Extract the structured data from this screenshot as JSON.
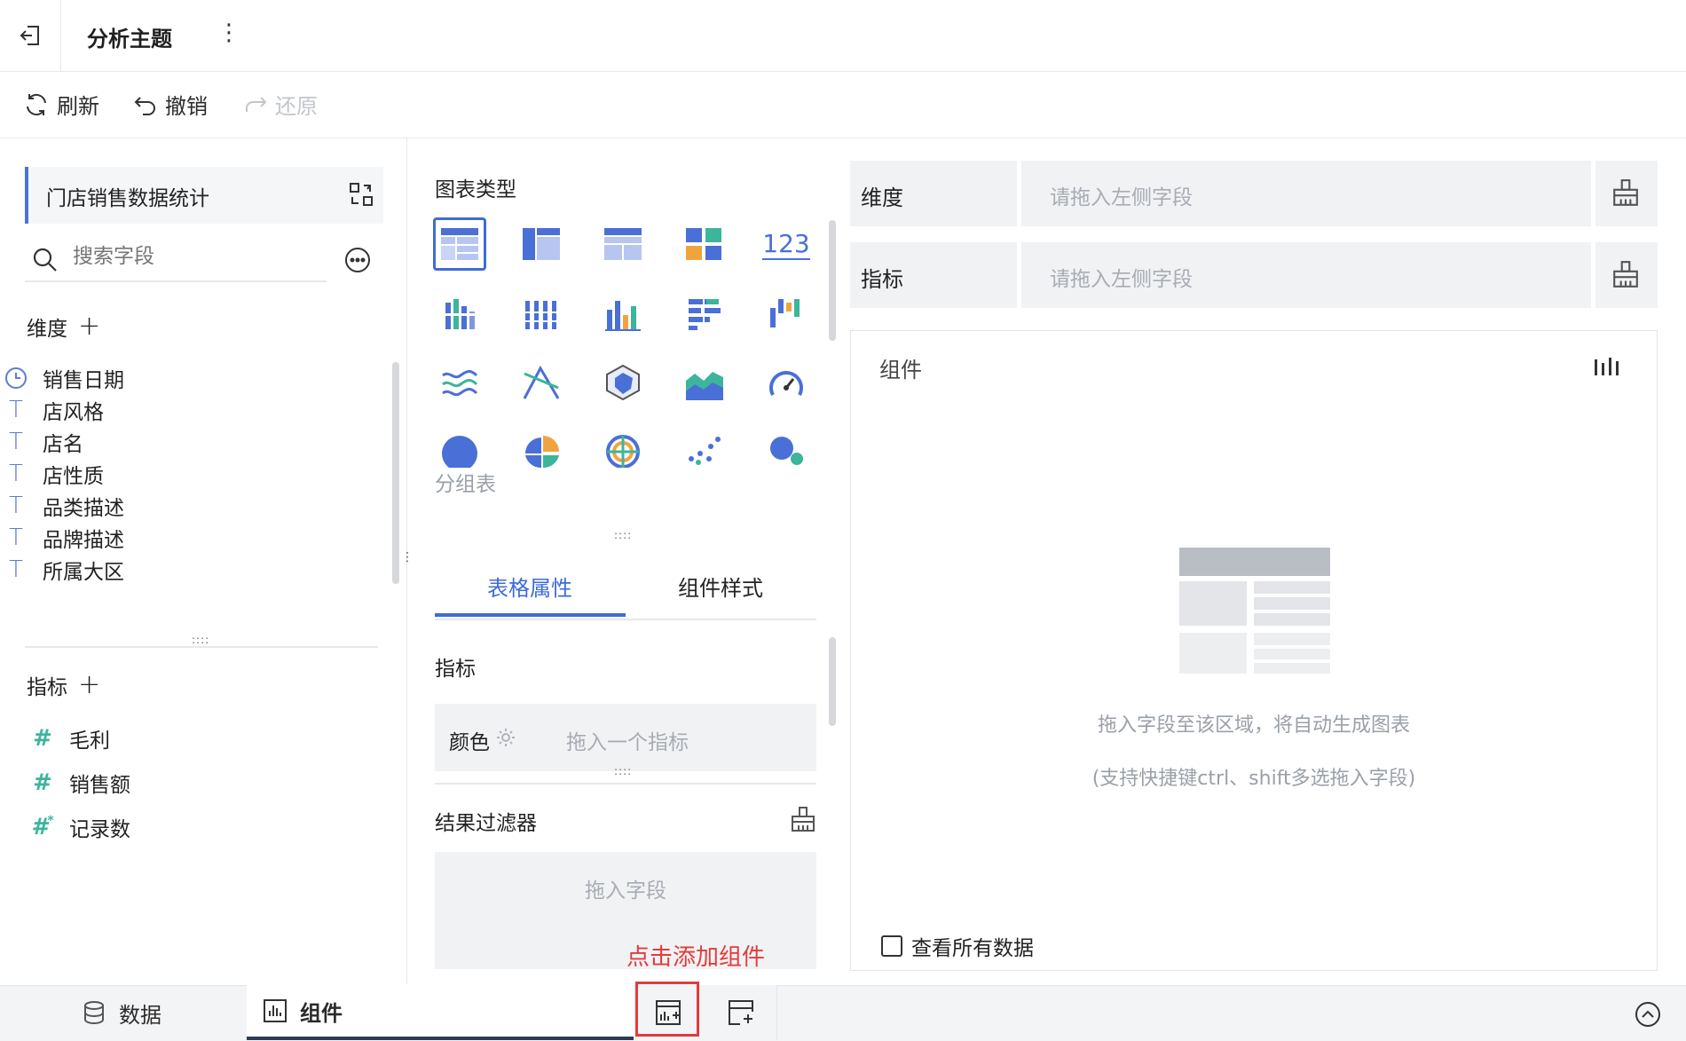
{
  "header": {
    "title": "分析主题",
    "more_icon": "⋮"
  },
  "toolbar": {
    "refresh": "刷新",
    "undo": "撤销",
    "redo": "还原"
  },
  "left": {
    "dataset_name": "门店销售数据统计",
    "search_placeholder": "搜索字段",
    "dimensions_title": "维度",
    "dimensions": [
      {
        "label": "销售日期",
        "icon": "clock-icon"
      },
      {
        "label": "店风格",
        "icon": "text-type-icon"
      },
      {
        "label": "店名",
        "icon": "text-type-icon"
      },
      {
        "label": "店性质",
        "icon": "text-type-icon"
      },
      {
        "label": "品类描述",
        "icon": "text-type-icon"
      },
      {
        "label": "品牌描述",
        "icon": "text-type-icon"
      },
      {
        "label": "所属大区",
        "icon": "text-type-icon"
      }
    ],
    "measures_title": "指标",
    "measures": [
      {
        "label": "毛利",
        "icon": "number-type-icon"
      },
      {
        "label": "销售额",
        "icon": "number-type-icon"
      },
      {
        "label": "记录数",
        "icon": "count-type-icon"
      }
    ]
  },
  "middle": {
    "chart_type_title": "图表类型",
    "selected_chart_label": "分组表",
    "tabs": [
      "表格属性",
      "组件样式"
    ],
    "measure_title": "指标",
    "color_label": "颜色",
    "color_placeholder": "拖入一个指标",
    "filter_title": "结果过滤器",
    "filter_placeholder": "拖入字段"
  },
  "right": {
    "dimension_label": "维度",
    "dimension_placeholder": "请拖入左侧字段",
    "measure_label": "指标",
    "measure_placeholder": "请拖入左侧字段",
    "component_title": "组件",
    "empty_hint_1": "拖入字段至该区域，将自动生成图表",
    "empty_hint_2": "(支持快捷键ctrl、shift多选拖入字段)",
    "view_all_label": "查看所有数据"
  },
  "bottom": {
    "data_tab": "数据",
    "component_tab": "组件",
    "annotation": "点击添加组件"
  },
  "colors": {
    "accent": "#3e6bd9",
    "annotation": "#e33b3b",
    "teal": "#3cb59b"
  }
}
